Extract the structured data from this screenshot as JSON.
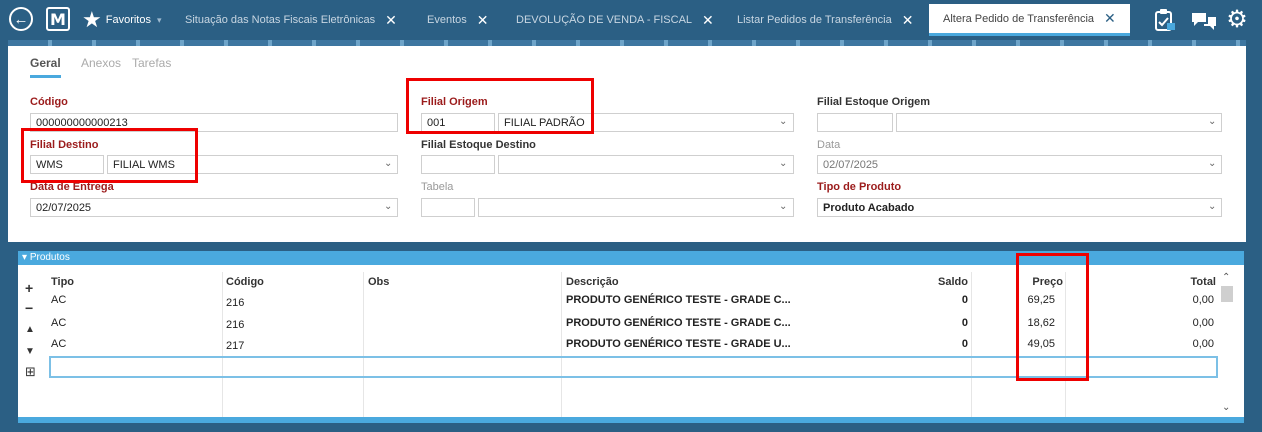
{
  "topbar": {
    "favorites_label": "Favoritos",
    "favorites_arrow": "▾",
    "tabs": [
      {
        "label": "Situação das Notas Fiscais Eletrônicas",
        "close": "✕"
      },
      {
        "label": "Eventos",
        "close": "✕"
      },
      {
        "label": "DEVOLUÇÃO DE VENDA - FISCAL",
        "close": "✕"
      },
      {
        "label": "Listar Pedidos de Transferência",
        "close": "✕"
      },
      {
        "label": "Altera Pedido de Transferência",
        "close": "✕"
      }
    ],
    "icons": {
      "back": "back-arrow-icon",
      "menu": "m-logo-icon",
      "favorites": "star-icon",
      "tasks": "clipboard-icon",
      "chat": "chat-icon",
      "settings": "gear-icon"
    },
    "colors": {
      "bar": "#2b5f84",
      "accent": "#4aa9de"
    }
  },
  "form": {
    "tabs": [
      "Geral",
      "Anexos",
      "Tarefas"
    ],
    "codigo": {
      "label": "Código",
      "value": "000000000000213"
    },
    "filial_destino": {
      "label": "Filial Destino",
      "code": "WMS",
      "name": "FILIAL WMS"
    },
    "data_entrega": {
      "label": "Data de Entrega",
      "value": "02/07/2025"
    },
    "filial_origem": {
      "label": "Filial Origem",
      "code": "001",
      "name": "FILIAL PADRÃO"
    },
    "filial_estoque_destino": {
      "label": "Filial Estoque Destino",
      "code": "",
      "name": ""
    },
    "tabela": {
      "label": "Tabela",
      "code": "",
      "name": ""
    },
    "filial_estoque_origem": {
      "label": "Filial Estoque Origem",
      "code": "",
      "name": ""
    },
    "data": {
      "label": "Data",
      "value": "02/07/2025"
    },
    "tipo_produto": {
      "label": "Tipo de Produto",
      "value": "Produto Acabado"
    },
    "highlight_color": "#e00000"
  },
  "produtos": {
    "title": "Produtos",
    "controls": {
      "add": "+",
      "remove": "−",
      "up": "▲",
      "down": "▼",
      "expand": "⊞"
    },
    "columns": [
      "Tipo",
      "Código",
      "Obs",
      "Descrição",
      "Saldo",
      "Preço",
      "Total"
    ],
    "rows": [
      {
        "tipo": "AC",
        "codigo": "216",
        "obs": "",
        "descricao": "PRODUTO GENÉRICO TESTE - GRADE C...",
        "saldo": "0",
        "preco": "69,25",
        "total": "0,00"
      },
      {
        "tipo": "AC",
        "codigo": "216",
        "obs": "",
        "descricao": "PRODUTO GENÉRICO TESTE - GRADE C...",
        "saldo": "0",
        "preco": "18,62",
        "total": "0,00"
      },
      {
        "tipo": "AC",
        "codigo": "217",
        "obs": "",
        "descricao": "PRODUTO GENÉRICO TESTE - GRADE U...",
        "saldo": "0",
        "preco": "49,05",
        "total": "0,00"
      }
    ]
  }
}
